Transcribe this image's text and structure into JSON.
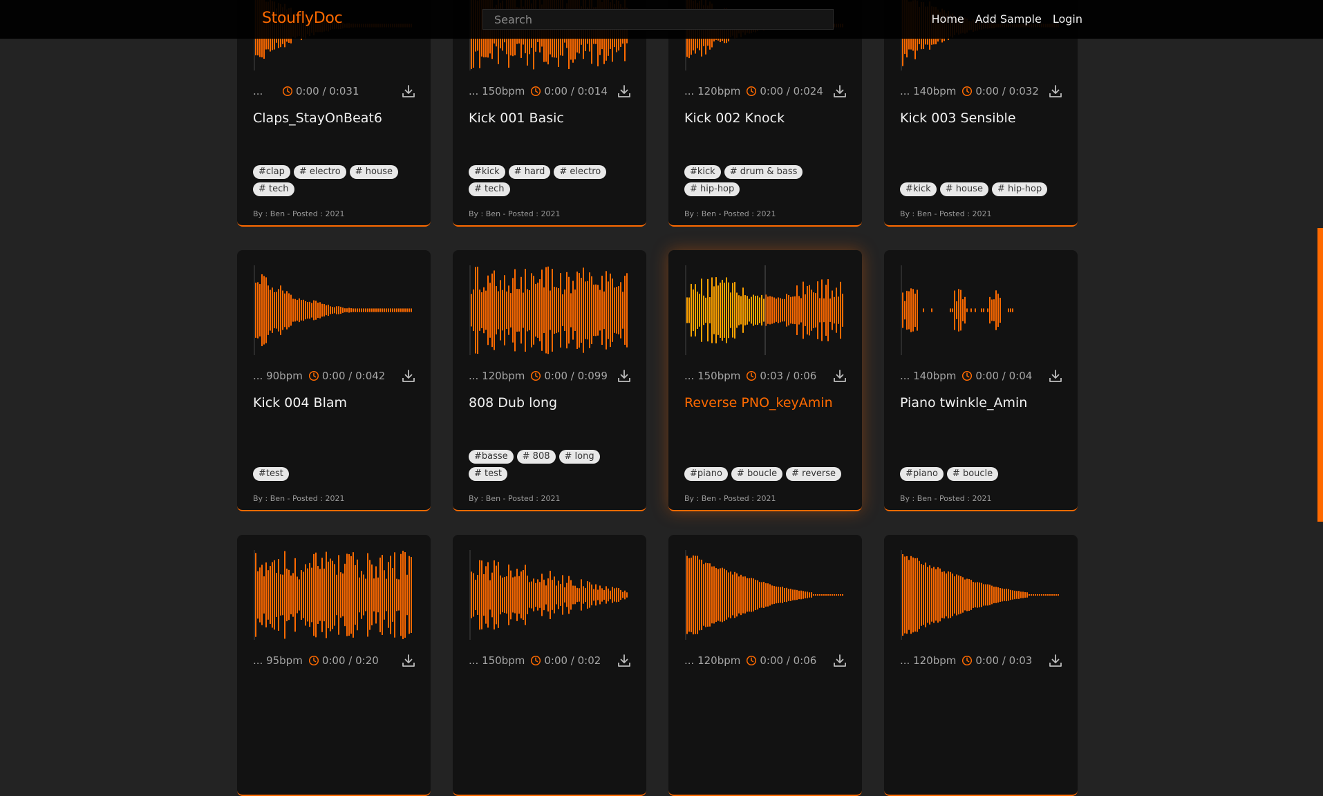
{
  "nav": {
    "brand": "StouflyDoc",
    "search_placeholder": "Search",
    "links": [
      "Home",
      "Add Sample",
      "Login"
    ]
  },
  "colors": {
    "accent": "#ff6a00",
    "accent_bright": "#ffa200",
    "card_bg": "#121212",
    "page_bg": "#232323"
  },
  "icons": {
    "clock": "clock-icon",
    "download": "download-icon"
  },
  "samples": [
    {
      "bpm": "...",
      "time": "0:00 / 0:031",
      "title": "Claps_StayOnBeat6",
      "tags": [
        "#clap",
        "# electro",
        "# house",
        "# tech"
      ],
      "byline": "By : Ben - Posted : 2021"
    },
    {
      "bpm": "... 150bpm",
      "time": "0:00 / 0:014",
      "title": "Kick 001 Basic",
      "tags": [
        "#kick",
        "# hard",
        "# electro",
        "# tech"
      ],
      "byline": "By : Ben - Posted : 2021"
    },
    {
      "bpm": "... 120bpm",
      "time": "0:00 / 0:024",
      "title": "Kick 002 Knock",
      "tags": [
        "#kick",
        "# drum & bass",
        "# hip-hop"
      ],
      "byline": "By : Ben - Posted : 2021"
    },
    {
      "bpm": "... 140bpm",
      "time": "0:00 / 0:032",
      "title": "Kick 003 Sensible",
      "tags": [
        "#kick",
        "# house",
        "# hip-hop"
      ],
      "byline": "By : Ben - Posted : 2021"
    },
    {
      "bpm": "... 90bpm",
      "time": "0:00 / 0:042",
      "title": "Kick 004 Blam",
      "tags": [
        "#test"
      ],
      "byline": "By : Ben - Posted : 2021"
    },
    {
      "bpm": "... 120bpm",
      "time": "0:00 / 0:099",
      "title": "808 Dub long",
      "tags": [
        "#basse",
        "# 808",
        "# long",
        "# test"
      ],
      "byline": "By : Ben - Posted : 2021"
    },
    {
      "bpm": "... 150bpm",
      "time": "0:03 / 0:06",
      "title": "Reverse PNO_keyAmin",
      "tags": [
        "#piano",
        "# boucle",
        "# reverse"
      ],
      "byline": "By : Ben - Posted : 2021",
      "active": true,
      "progress": 0.5
    },
    {
      "bpm": "... 140bpm",
      "time": "0:00 / 0:04",
      "title": "Piano twinkle_Amin",
      "tags": [
        "#piano",
        "# boucle"
      ],
      "byline": "By : Ben - Posted : 2021"
    },
    {
      "bpm": "... 95bpm",
      "time": "0:00 / 0:20",
      "title": "",
      "tags": [],
      "byline": ""
    },
    {
      "bpm": "... 150bpm",
      "time": "0:00 / 0:02",
      "title": "",
      "tags": [],
      "byline": ""
    },
    {
      "bpm": "... 120bpm",
      "time": "0:00 / 0:06",
      "title": "",
      "tags": [],
      "byline": ""
    },
    {
      "bpm": "... 120bpm",
      "time": "0:00 / 0:03",
      "title": "",
      "tags": [],
      "byline": ""
    }
  ]
}
